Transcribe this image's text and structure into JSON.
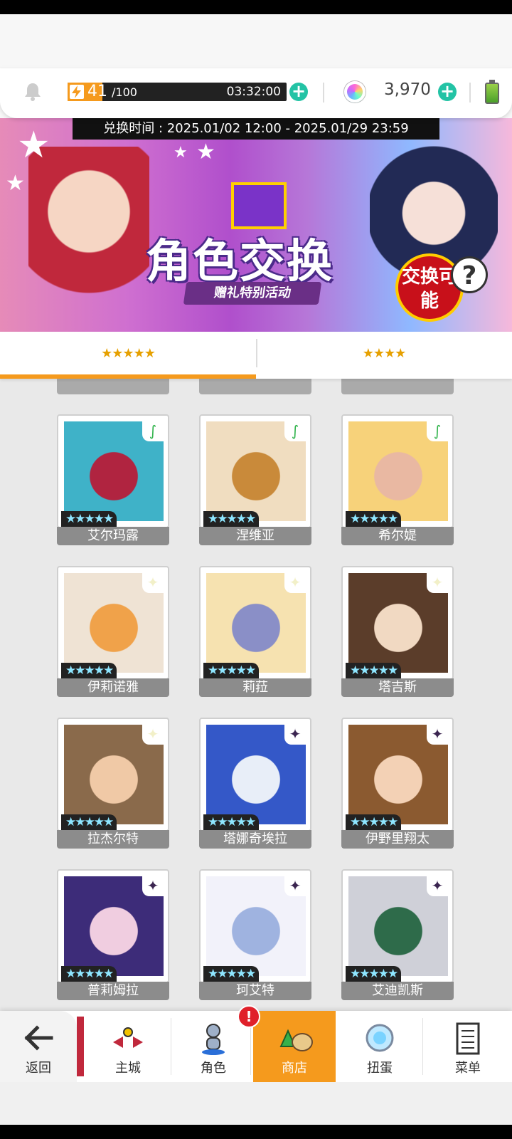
{
  "header": {
    "stamina_current": "41",
    "stamina_max": "/100",
    "stamina_fraction": 0.41,
    "stamina_timer": "03:32:00",
    "gem_count": "3,970"
  },
  "banner": {
    "exchange_time": "兑换时间 : 2025.01/02 12:00 - 2025.01/29 23:59",
    "title": "角色交换",
    "subtitle": "赠礼特别活动",
    "badge": "交换可能",
    "help_symbol": "?"
  },
  "tabs": [
    {
      "label": "★★★★★",
      "active": true
    },
    {
      "label": "★★★★",
      "active": false
    }
  ],
  "cards": [
    {
      "name": "艾尔玛露",
      "stars": "★★★★★",
      "element": "wind",
      "element_glyph": "∫",
      "colors": [
        "#3fb2c8",
        "#b02440"
      ]
    },
    {
      "name": "涅维亚",
      "stars": "★★★★★",
      "element": "wind",
      "element_glyph": "∫",
      "colors": [
        "#f0ddc0",
        "#c98a3a"
      ]
    },
    {
      "name": "希尔媞",
      "stars": "★★★★★",
      "element": "wind",
      "element_glyph": "∫",
      "colors": [
        "#f7d27a",
        "#e9b8a2"
      ]
    },
    {
      "name": "伊莉诺雅",
      "stars": "★★★★★",
      "element": "light",
      "element_glyph": "✦",
      "colors": [
        "#efe3d4",
        "#f0a24a"
      ]
    },
    {
      "name": "莉菈",
      "stars": "★★★★★",
      "element": "light",
      "element_glyph": "✦",
      "colors": [
        "#f6e2b0",
        "#8a8fc7"
      ]
    },
    {
      "name": "塔吉斯",
      "stars": "★★★★★",
      "element": "light",
      "element_glyph": "✦",
      "colors": [
        "#5b3d2a",
        "#f1d9c2"
      ]
    },
    {
      "name": "拉杰尔特",
      "stars": "★★★★★",
      "element": "light",
      "element_glyph": "✦",
      "colors": [
        "#8a6a4b",
        "#f0c9a6"
      ]
    },
    {
      "name": "塔娜奇埃拉",
      "stars": "★★★★★",
      "element": "dark",
      "element_glyph": "✦",
      "colors": [
        "#3458c8",
        "#e8eef8"
      ]
    },
    {
      "name": "伊野里翔太",
      "stars": "★★★★★",
      "element": "dark",
      "element_glyph": "✦",
      "colors": [
        "#8b5a30",
        "#f3d1b5"
      ]
    },
    {
      "name": "普莉姆拉",
      "stars": "★★★★★",
      "element": "dark",
      "element_glyph": "✦",
      "colors": [
        "#3d2c79",
        "#f0cde0"
      ]
    },
    {
      "name": "珂艾特",
      "stars": "★★★★★",
      "element": "dark",
      "element_glyph": "✦",
      "colors": [
        "#f2f2fa",
        "#9fb3e0"
      ]
    },
    {
      "name": "艾迪凯斯",
      "stars": "★★★★★",
      "element": "dark",
      "element_glyph": "✦",
      "colors": [
        "#cfd0d8",
        "#2e6b4a"
      ]
    }
  ],
  "nav": {
    "back": "返回",
    "items": [
      {
        "label": "主城",
        "icon": "castle-icon"
      },
      {
        "label": "角色",
        "icon": "character-icon"
      },
      {
        "label": "商店",
        "icon": "shop-icon",
        "active": true
      },
      {
        "label": "扭蛋",
        "icon": "gacha-icon"
      },
      {
        "label": "菜单",
        "icon": "menu-icon"
      }
    ],
    "alert_symbol": "!"
  }
}
